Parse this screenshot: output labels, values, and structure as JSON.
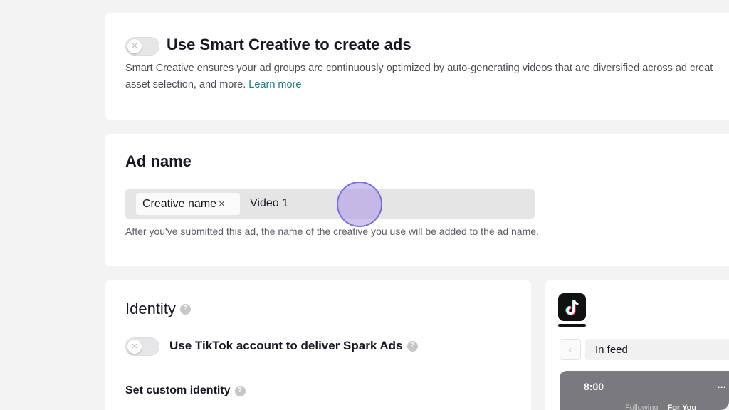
{
  "smart_creative": {
    "toggle_state": "off",
    "title": "Use Smart Creative to create ads",
    "description_line1": "Smart Creative ensures your ad groups are continuously optimized by auto-generating videos that are diversified across ad creat",
    "description_line2": "asset selection, and more.",
    "learn_more": "Learn more"
  },
  "ad_name": {
    "title": "Ad name",
    "chip_label": "Creative name",
    "chip_close": "×",
    "value": "Video 1",
    "hint": "After you've submitted this ad, the name of the creative you use will be added to the ad name."
  },
  "identity": {
    "title": "Identity",
    "spark_toggle_state": "off",
    "spark_label": "Use TikTok account to deliver Spark Ads",
    "custom_identity_label": "Set custom identity",
    "help_icon": "?"
  },
  "preview": {
    "logo_icon": "tiktok-logo-icon",
    "prev_arrow": "‹",
    "placement": "In feed",
    "phone_time": "8:00",
    "phone_signal": "•••",
    "tab_following": "Following",
    "tab_for_you": "For You"
  },
  "colors": {
    "accent_link": "#1b7a84",
    "cursor_fill": "#aa96e6",
    "cursor_ring": "#7f6ad9"
  }
}
